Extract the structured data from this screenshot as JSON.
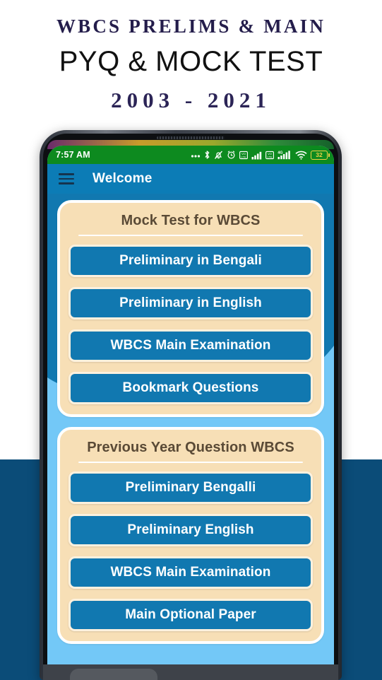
{
  "promo": {
    "line1": "WBCS PRELIMS & MAIN",
    "line2": "PYQ & MOCK TEST",
    "line3": "2003 - 2021",
    "navy_color": "#241d4b",
    "band_color": "#0b4c78"
  },
  "phone": {
    "status_bar": {
      "time": "7:57 AM",
      "background_color": "#0d8a1f",
      "battery_level": "32",
      "icons": [
        "more-dots-icon",
        "bluetooth-icon",
        "notifications-muted-icon",
        "alarm-clock-icon",
        "volte-sim1-icon",
        "signal-sim1-icon",
        "volte-sim2-icon",
        "signal-4g-sim2-icon",
        "wifi-icon",
        "battery-icon"
      ]
    },
    "app_bar": {
      "menu_icon": "hamburger-menu-icon",
      "title": "Welcome",
      "background_color": "#0c7cb6"
    },
    "screen": {
      "background_color": "#73c8f7",
      "wave_color": "#1178b0",
      "cards": [
        {
          "title": "Mock Test for WBCS",
          "buttons": [
            "Preliminary in Bengali",
            "Preliminary in English",
            "WBCS Main Examination",
            "Bookmark Questions"
          ]
        },
        {
          "title": "Previous Year Question WBCS",
          "buttons": [
            "Preliminary Bengalli",
            "Preliminary English",
            "WBCS Main Examination",
            "Main Optional Paper"
          ]
        }
      ],
      "card_background_color": "#f7dfb6",
      "button_color": "#1178b0",
      "title_color": "#5a4a36"
    }
  }
}
